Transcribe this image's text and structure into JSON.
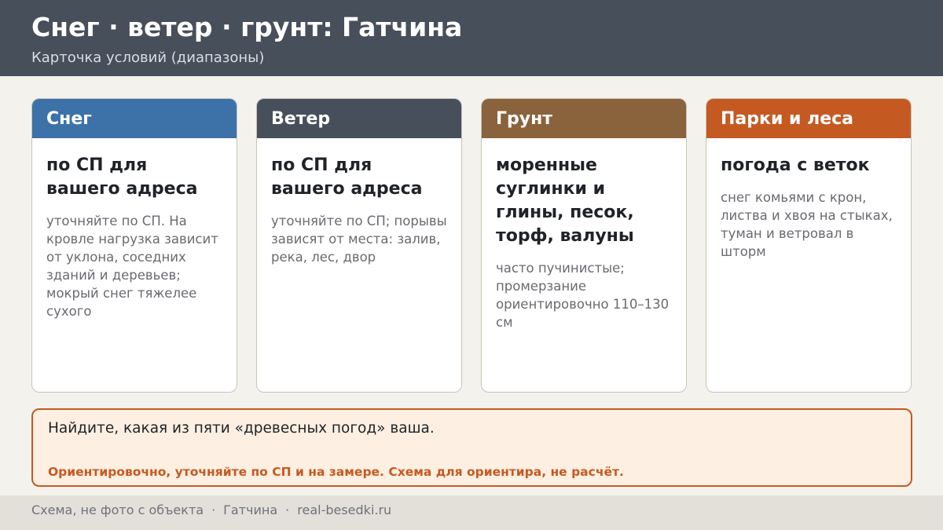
{
  "header": {
    "title": "Снег · ветер · грунт: Гатчина",
    "subtitle": "Карточка условий (диапазоны)",
    "background": "#474f5b"
  },
  "cards": [
    {
      "title": "Снег",
      "color": "#3c72a8",
      "main": "по СП для вашего адреса",
      "note": "уточняйте по СП. На кровле нагрузка зависит от уклона, соседних зданий и деревьев; мокрый снег тяжелее сухого"
    },
    {
      "title": "Ветер",
      "color": "#474f5b",
      "main": "по СП для вашего адреса",
      "note": "уточняйте по СП; порывы зависят от места: залив, река, лес, двор"
    },
    {
      "title": "Грунт",
      "color": "#8a623c",
      "main": "моренные суглинки и глины, песок, торф, валуны",
      "note": "часто пучинистые; промерзание ориентировочно 110–130 см"
    },
    {
      "title": "Парки и леса",
      "color": "#c45a22",
      "main": "погода с веток",
      "note": "снег комьями с крон, листва и хвоя на стыках, туман и ветровал в шторм"
    }
  ],
  "notice": {
    "main": "Найдите, какая из пяти «древесных погод» ваша.",
    "warning": "Ориентировочно, уточняйте по СП и на замере. Схема для ориентира, не расчёт.",
    "accent": "#c45a22"
  },
  "footer": {
    "part1": "Схема, не фото с объекта",
    "part2": "Гатчина",
    "part3": "real-besedki.ru",
    "separator": "·"
  }
}
